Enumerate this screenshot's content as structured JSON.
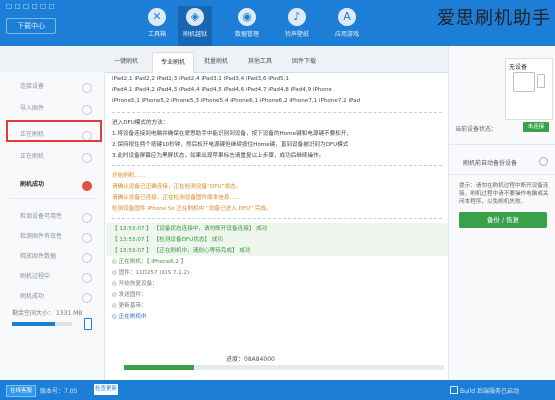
{
  "window": {
    "title": "爱思刷机助手",
    "controls": "☐ ☐ ☐ ☐ ☐ ☐",
    "watermark": "爱思刷机助手"
  },
  "header": {
    "brand_badge": "下载中心",
    "nav": [
      {
        "label": "工具箱",
        "icon": "wrench-icon"
      },
      {
        "label": "刷机越狱",
        "icon": "box-icon"
      },
      {
        "label": "数据管理",
        "icon": "compass-icon"
      },
      {
        "label": "铃声壁纸",
        "icon": "bell-icon"
      },
      {
        "label": "应用游戏",
        "icon": "appstore-icon"
      }
    ]
  },
  "tabs": [
    "一键刷机",
    "专业刷机",
    "批量刷机",
    "其他工具",
    "固件下载"
  ],
  "sidebar": {
    "items": [
      "连接设备",
      "导入固件",
      "正在刷机",
      "正在刷机",
      "刷机成功",
      "检测设备可用性",
      "检测固件有效性",
      "释放固件数据",
      "刷机过程中",
      "刷机成功"
    ],
    "storage_label": "剩余空间大小：",
    "storage_value": "1331 MB",
    "storage_fraction": 0.72
  },
  "log": {
    "lines": [
      {
        "t": "iPad2,1 iPad2,2 iPad2,3 iPad2,4 iPad3,1 iPad3,4 iPad3,6 iPod5,1",
        "c": ""
      },
      {
        "t": "iPad4,1 iPad4,2 iPad4,3 iPad4,4 iPad4,5 iPad4,6 iPad4,7 iPad4,8 iPad4,9 iPhone",
        "c": ""
      },
      {
        "t": "iPhone5,1 iPhone5,2 iPhone5,3 iPhone5,4 iPhone6,1 iPhone6,2 iPhone7,1 iPhone7,2 iPad",
        "c": ""
      },
      {
        "t": "",
        "c": "dash"
      },
      {
        "t": "进入DFU模式的方法：",
        "c": ""
      },
      {
        "t": "1.将设备连接到电脑并确保在爱思助手中能识别到设备，按下设备的Home键和电源键不要松开，",
        "c": ""
      },
      {
        "t": "2.保持按住两个按键10秒钟，然后松开电源键但继续按住Home键，直到设备被识别为DFU模式",
        "c": ""
      },
      {
        "t": "3.此时设备屏幕应为黑屏状态，如果出现苹果标志请重复以上步骤，成功后继续操作。",
        "c": ""
      },
      {
        "t": "",
        "c": "dash"
      },
      {
        "t": "开始刷机……",
        "c": "orange"
      },
      {
        "t": "请确认设备已正确连接，正在检测设备“DFU”状态。",
        "c": "orange"
      },
      {
        "t": "请确认设备已连接，正在检测设备固件版本信息……",
        "c": "orange"
      },
      {
        "t": "检测设备固件 iPhone 5s 正在刷机中 “设备已进入 DFU” 完成。",
        "c": "orange"
      },
      {
        "t": "",
        "c": "dash"
      },
      {
        "t": "【 13:53:07 】 【设备状态连接中，请勿断开设备连接】    成功",
        "c": "green"
      },
      {
        "t": "【 13:53:07 】 【检测设备DFU状态】    成功",
        "c": "green"
      },
      {
        "t": "【 13:53:07 】 【正在刷机中，请耐心等待完成】    成功",
        "c": "green"
      },
      {
        "t": "◎ 正在刷机：【 iPhone6,2 】",
        "c": "green"
      },
      {
        "t": "◎ 固件：11D257 (iOS 7.1.2)",
        "c": "gray"
      },
      {
        "t": "◎ 开始恢复设备：",
        "c": "gray"
      },
      {
        "t": "◎ 发送固件：",
        "c": "gray"
      },
      {
        "t": "◎ 更新基带：",
        "c": "gray"
      },
      {
        "t": "◎ 正在刷机中",
        "c": "blue"
      }
    ],
    "progress_label": "进度：08A84000",
    "progress_fraction": 0.22
  },
  "right": {
    "device_name": "无设备",
    "status_label": "当前设备状态：",
    "status_badge": "未连接",
    "option_label": "刷机前自动备份设备",
    "note": "提示：请勿在刷机过程中断开设备连接，刷机过程中请不要操作电脑或关闭本程序，以免刷机失败。",
    "action_button": "备份 / 恢复"
  },
  "footer": {
    "badge": "在线客服",
    "version": "版本号：7.05",
    "update_button": "检查更新",
    "right_label": "Build 后端服务已启动"
  },
  "colors": {
    "primary": "#1d7ed7",
    "success": "#3aa14a",
    "warning": "#d68a1d",
    "alert": "#e23b3b"
  }
}
